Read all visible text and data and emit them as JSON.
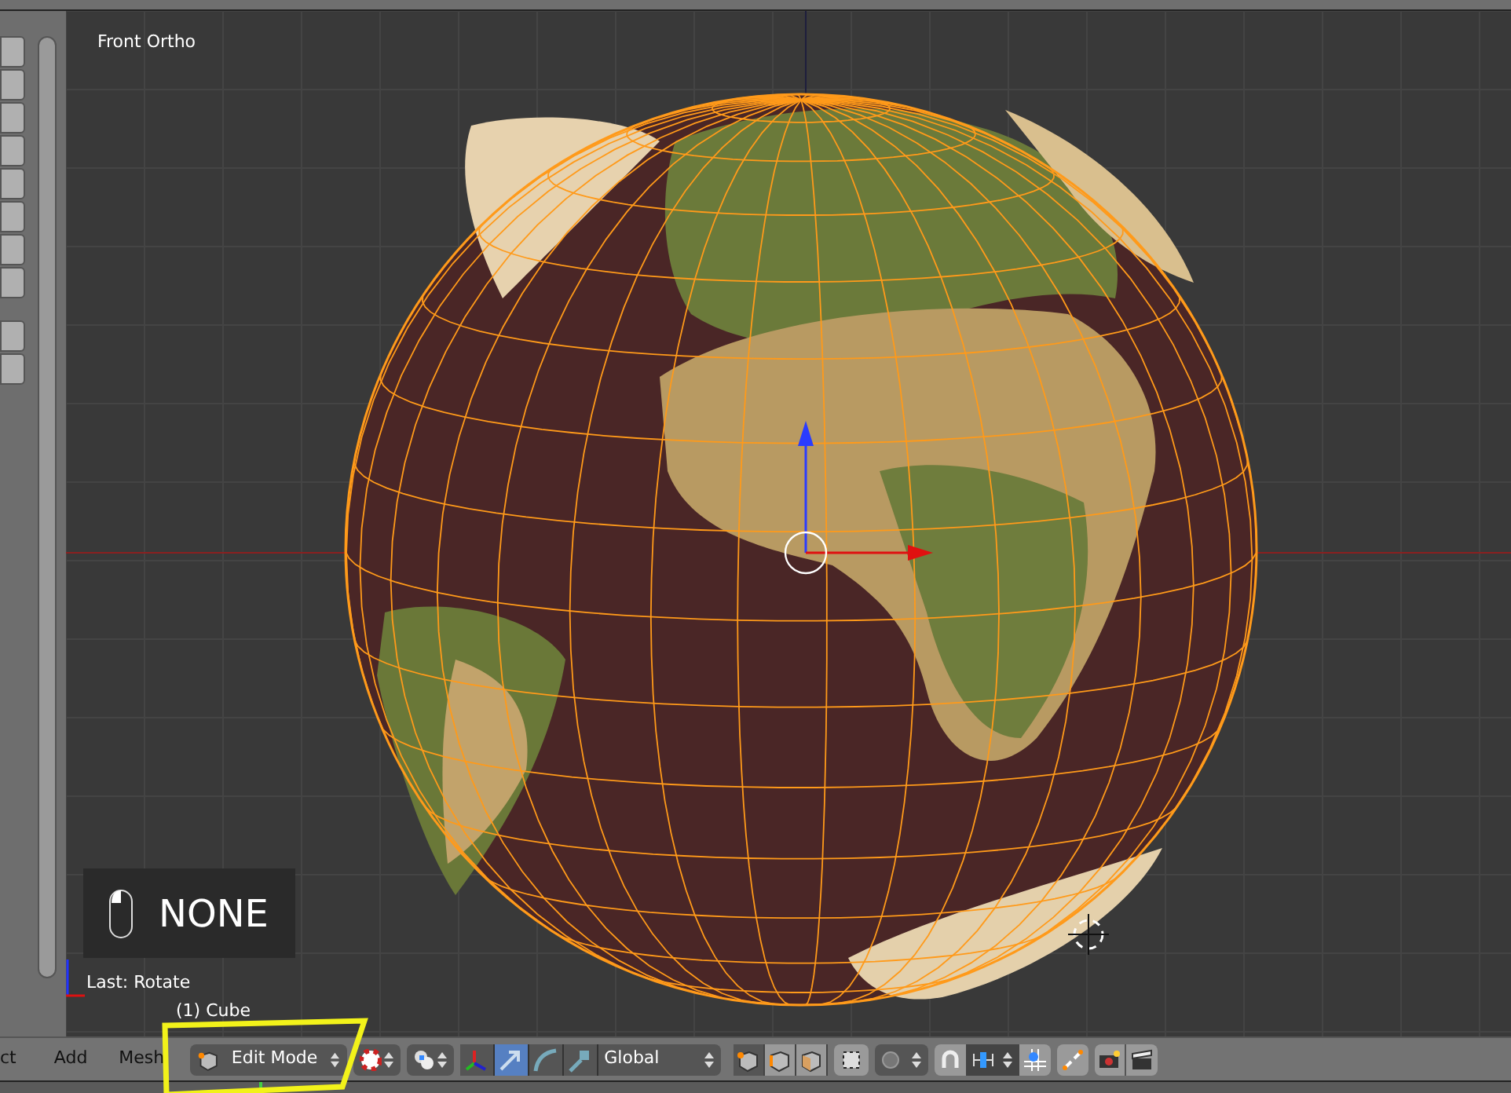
{
  "viewport": {
    "view_label": "Front Ortho",
    "key_display": "NONE",
    "last_operator": "Last: Rotate",
    "object_label": "(1) Cube"
  },
  "header": {
    "menus": [
      {
        "label": "ct"
      },
      {
        "label": "Add"
      },
      {
        "label": "Mesh"
      }
    ],
    "mode": "Edit Mode",
    "manipulators": [
      {
        "kind": "axes",
        "selected": false
      },
      {
        "kind": "translate",
        "selected": true
      },
      {
        "kind": "rotate",
        "selected": false
      },
      {
        "kind": "scale",
        "selected": false
      }
    ],
    "orientation": "Global",
    "select_modes": [
      {
        "kind": "vertex",
        "selected": true
      },
      {
        "kind": "edge",
        "selected": false
      },
      {
        "kind": "face",
        "selected": false
      }
    ],
    "snap": {
      "on": false
    }
  }
}
